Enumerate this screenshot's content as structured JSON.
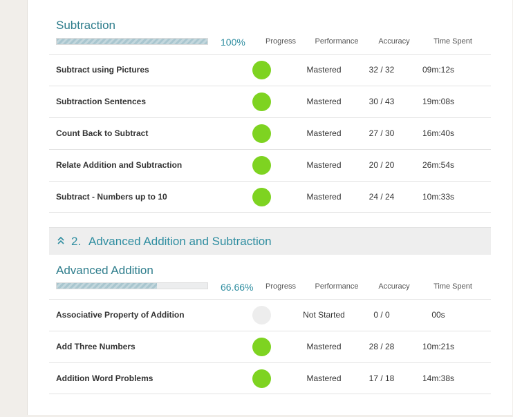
{
  "colors": {
    "accent": "#2e8da0",
    "mastered": "#7ed321",
    "not_started": "#ededed"
  },
  "headers": {
    "progress": "Progress",
    "performance": "Performance",
    "accuracy": "Accuracy",
    "time_spent": "Time Spent"
  },
  "sections": [
    {
      "title": "Subtraction",
      "progress_pct": "100%",
      "progress_fraction": 1.0,
      "skills": [
        {
          "name": "Subtract using Pictures",
          "status": "mastered",
          "performance": "Mastered",
          "accuracy": "32 / 32",
          "time": "09m:12s"
        },
        {
          "name": "Subtraction Sentences",
          "status": "mastered",
          "performance": "Mastered",
          "accuracy": "30 / 43",
          "time": "19m:08s"
        },
        {
          "name": "Count Back to Subtract",
          "status": "mastered",
          "performance": "Mastered",
          "accuracy": "27 / 30",
          "time": "16m:40s"
        },
        {
          "name": "Relate Addition and Subtraction",
          "status": "mastered",
          "performance": "Mastered",
          "accuracy": "20 / 20",
          "time": "26m:54s"
        },
        {
          "name": "Subtract - Numbers up to 10",
          "status": "mastered",
          "performance": "Mastered",
          "accuracy": "24 / 24",
          "time": "10m:33s"
        }
      ]
    },
    {
      "title": "Advanced Addition",
      "progress_pct": "66.66%",
      "progress_fraction": 0.6666,
      "skills": [
        {
          "name": "Associative Property of Addition",
          "status": "not_started",
          "performance": "Not Started",
          "accuracy": "0 / 0",
          "time": "00s"
        },
        {
          "name": "Add Three Numbers",
          "status": "mastered",
          "performance": "Mastered",
          "accuracy": "28 / 28",
          "time": "10m:21s"
        },
        {
          "name": "Addition Word Problems",
          "status": "mastered",
          "performance": "Mastered",
          "accuracy": "17 / 18",
          "time": "14m:38s"
        }
      ]
    }
  ],
  "unit": {
    "number": "2.",
    "title": "Advanced Addition and Subtraction",
    "icon": "double-chevron-up-icon"
  }
}
